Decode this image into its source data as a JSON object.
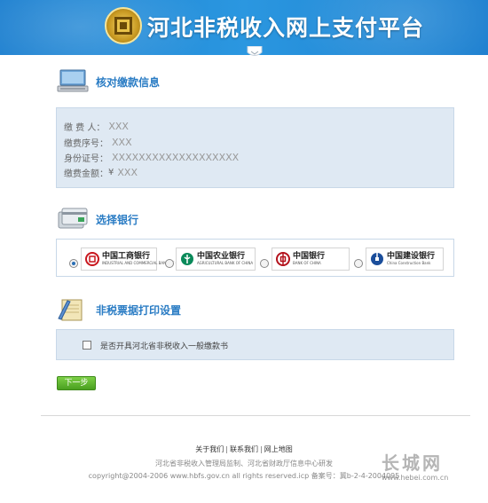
{
  "header": {
    "site_title": "河北非税收入网上支付平台"
  },
  "sections": {
    "verify": {
      "title": "核对缴款信息"
    },
    "bank": {
      "title": "选择银行"
    },
    "print": {
      "title": "非税票据打印设置"
    }
  },
  "payment_info": {
    "payer_label": "缴 费 人：",
    "payer_value": "XXX",
    "serial_label": "缴费序号：",
    "serial_value": "XXX",
    "id_label": "身份证号：",
    "id_value": "XXXXXXXXXXXXXXXXXXX",
    "amount_label": "缴费金额：",
    "currency": "¥",
    "amount_value": "XXX"
  },
  "banks": [
    {
      "cn": "中国工商银行",
      "en": "INDUSTRIAL AND COMMERCIAL BANK OF CHINA",
      "color": "#c8161d",
      "checked": true
    },
    {
      "cn": "中国农业银行",
      "en": "AGRICULTURAL BANK OF CHINA",
      "color": "#0a8a5a",
      "checked": false
    },
    {
      "cn": "中国银行",
      "en": "BANK OF CHINA",
      "color": "#b3121c",
      "checked": false
    },
    {
      "cn": "中国建设银行",
      "en": "China Construction Bank",
      "color": "#1b4e9b",
      "checked": false
    }
  ],
  "print_option": {
    "label": "是否开具河北省非税收入一般缴款书",
    "checked": false
  },
  "next_button": {
    "label": "下一步"
  },
  "footer": {
    "links": [
      "关于我们",
      "联系我们",
      "网上地图"
    ],
    "line1": "河北省非税收入管理局监制、河北省财政厅信息中心研发",
    "line2": "copyright@2004-2006 www.hbfs.gov.cn all rights reserved.icp 备案号：冀b-2-4-2004095"
  },
  "watermark": {
    "text": "长城网",
    "url": "www.hebei.com.cn"
  },
  "colors": {
    "header_blue": "#2b97e0",
    "section_title": "#2a7cc4",
    "panel_bg": "#dfe9f3",
    "button_green": "#4aa020"
  }
}
